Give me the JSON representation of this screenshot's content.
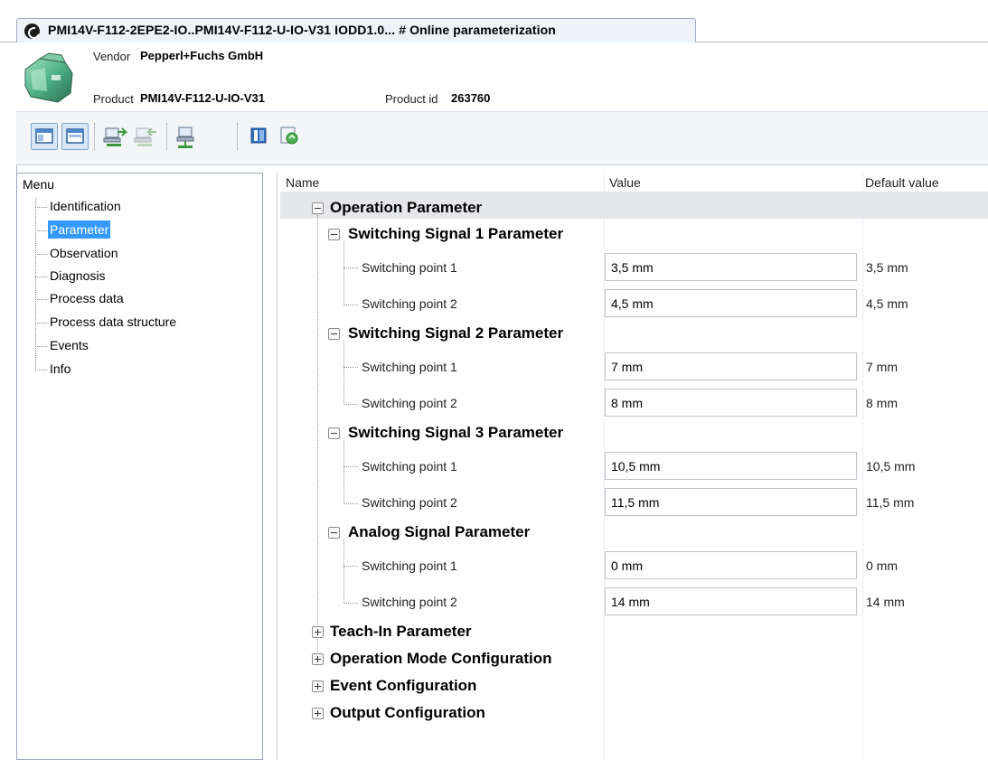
{
  "tab": {
    "title": "PMI14V-F112-2EPE2-IO..PMI14V-F112-U-IO-V31 IODD1.0... # Online parameterization"
  },
  "device": {
    "vendor_label": "Vendor",
    "vendor_value": "Pepperl+Fuchs GmbH",
    "product_label": "Product",
    "product_value": "PMI14V-F112-U-IO-V31",
    "product_id_label": "Product id",
    "product_id_value": "263760"
  },
  "toolbar": {
    "buttons": [
      "window-icon",
      "window-icon",
      "upload-device-icon",
      "download-device-icon",
      "connect-device-icon",
      "book-icon",
      "refresh-icon"
    ]
  },
  "menu": {
    "title": "Menu",
    "items": [
      {
        "label": "Identification",
        "selected": false
      },
      {
        "label": "Parameter",
        "selected": true
      },
      {
        "label": "Observation",
        "selected": false
      },
      {
        "label": "Diagnosis",
        "selected": false
      },
      {
        "label": "Process data",
        "selected": false
      },
      {
        "label": "Process data structure",
        "selected": false
      },
      {
        "label": "Events",
        "selected": false
      },
      {
        "label": "Info",
        "selected": false
      }
    ]
  },
  "grid": {
    "columns": {
      "name": "Name",
      "value": "Value",
      "default": "Default value"
    },
    "operation_parameter": "Operation Parameter",
    "groups": [
      {
        "title": "Switching Signal 1 Parameter",
        "params": [
          {
            "name": "Switching point 1",
            "value": "3,5 mm",
            "default": "3,5 mm"
          },
          {
            "name": "Switching point 2",
            "value": "4,5 mm",
            "default": "4,5 mm"
          }
        ]
      },
      {
        "title": "Switching Signal 2 Parameter",
        "params": [
          {
            "name": "Switching point 1",
            "value": "7 mm",
            "default": "7 mm"
          },
          {
            "name": "Switching point 2",
            "value": "8 mm",
            "default": "8 mm"
          }
        ]
      },
      {
        "title": "Switching Signal 3 Parameter",
        "params": [
          {
            "name": "Switching point 1",
            "value": "10,5 mm",
            "default": "10,5 mm"
          },
          {
            "name": "Switching point 2",
            "value": "11,5 mm",
            "default": "11,5 mm"
          }
        ]
      },
      {
        "title": "Analog Signal Parameter",
        "params": [
          {
            "name": "Switching point 1",
            "value": "0 mm",
            "default": "0 mm"
          },
          {
            "name": "Switching point 2",
            "value": "14 mm",
            "default": "14 mm"
          }
        ]
      }
    ],
    "collapsed_groups": [
      "Teach-In Parameter",
      "Operation Mode Configuration",
      "Event Configuration",
      "Output Configuration"
    ]
  }
}
